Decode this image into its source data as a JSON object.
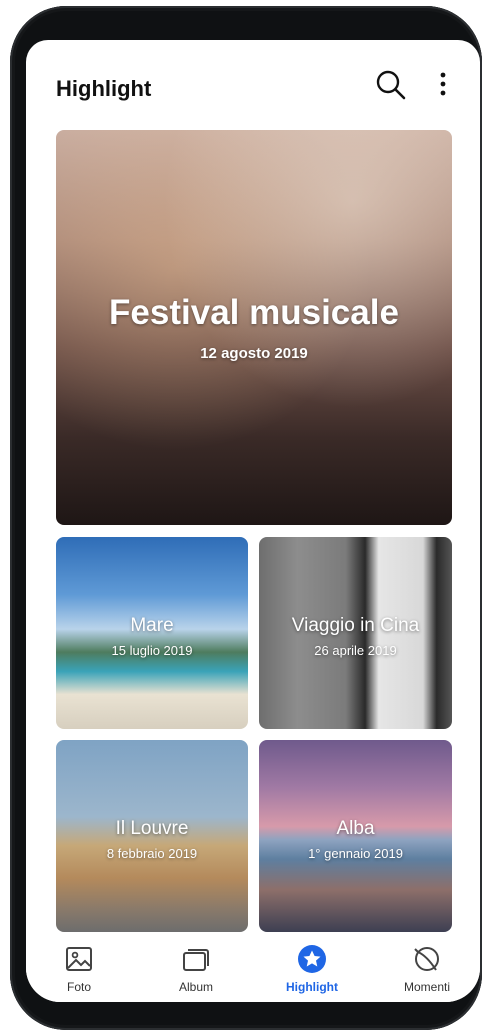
{
  "header": {
    "title": "Highlight"
  },
  "featured": {
    "title": "Festival musicale",
    "date": "12 agosto 2019"
  },
  "cards": [
    {
      "title": "Mare",
      "date": "15 luglio 2019"
    },
    {
      "title": "Viaggio in Cina",
      "date": "26 aprile 2019"
    },
    {
      "title": "Il Louvre",
      "date": "8 febbraio 2019"
    },
    {
      "title": "Alba",
      "date": "1° gennaio 2019"
    }
  ],
  "nav": {
    "items": [
      {
        "label": "Foto",
        "icon": "image-icon"
      },
      {
        "label": "Album",
        "icon": "album-icon"
      },
      {
        "label": "Highlight",
        "icon": "star-icon"
      },
      {
        "label": "Momenti",
        "icon": "momenti-icon"
      }
    ],
    "active_color": "#1f66e5"
  }
}
